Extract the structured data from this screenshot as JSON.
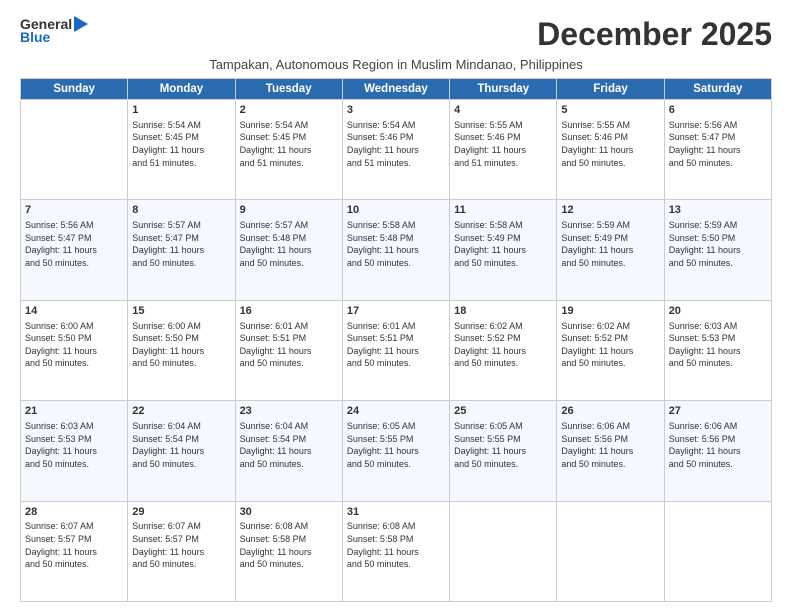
{
  "logo": {
    "general": "General",
    "blue": "Blue"
  },
  "title": "December 2025",
  "subtitle": "Tampakan, Autonomous Region in Muslim Mindanao, Philippines",
  "days": [
    "Sunday",
    "Monday",
    "Tuesday",
    "Wednesday",
    "Thursday",
    "Friday",
    "Saturday"
  ],
  "weeks": [
    [
      {
        "date": "",
        "info": ""
      },
      {
        "date": "1",
        "info": "Sunrise: 5:54 AM\nSunset: 5:45 PM\nDaylight: 11 hours\nand 51 minutes."
      },
      {
        "date": "2",
        "info": "Sunrise: 5:54 AM\nSunset: 5:45 PM\nDaylight: 11 hours\nand 51 minutes."
      },
      {
        "date": "3",
        "info": "Sunrise: 5:54 AM\nSunset: 5:46 PM\nDaylight: 11 hours\nand 51 minutes."
      },
      {
        "date": "4",
        "info": "Sunrise: 5:55 AM\nSunset: 5:46 PM\nDaylight: 11 hours\nand 51 minutes."
      },
      {
        "date": "5",
        "info": "Sunrise: 5:55 AM\nSunset: 5:46 PM\nDaylight: 11 hours\nand 50 minutes."
      },
      {
        "date": "6",
        "info": "Sunrise: 5:56 AM\nSunset: 5:47 PM\nDaylight: 11 hours\nand 50 minutes."
      }
    ],
    [
      {
        "date": "7",
        "info": "Sunrise: 5:56 AM\nSunset: 5:47 PM\nDaylight: 11 hours\nand 50 minutes."
      },
      {
        "date": "8",
        "info": "Sunrise: 5:57 AM\nSunset: 5:47 PM\nDaylight: 11 hours\nand 50 minutes."
      },
      {
        "date": "9",
        "info": "Sunrise: 5:57 AM\nSunset: 5:48 PM\nDaylight: 11 hours\nand 50 minutes."
      },
      {
        "date": "10",
        "info": "Sunrise: 5:58 AM\nSunset: 5:48 PM\nDaylight: 11 hours\nand 50 minutes."
      },
      {
        "date": "11",
        "info": "Sunrise: 5:58 AM\nSunset: 5:49 PM\nDaylight: 11 hours\nand 50 minutes."
      },
      {
        "date": "12",
        "info": "Sunrise: 5:59 AM\nSunset: 5:49 PM\nDaylight: 11 hours\nand 50 minutes."
      },
      {
        "date": "13",
        "info": "Sunrise: 5:59 AM\nSunset: 5:50 PM\nDaylight: 11 hours\nand 50 minutes."
      }
    ],
    [
      {
        "date": "14",
        "info": "Sunrise: 6:00 AM\nSunset: 5:50 PM\nDaylight: 11 hours\nand 50 minutes."
      },
      {
        "date": "15",
        "info": "Sunrise: 6:00 AM\nSunset: 5:50 PM\nDaylight: 11 hours\nand 50 minutes."
      },
      {
        "date": "16",
        "info": "Sunrise: 6:01 AM\nSunset: 5:51 PM\nDaylight: 11 hours\nand 50 minutes."
      },
      {
        "date": "17",
        "info": "Sunrise: 6:01 AM\nSunset: 5:51 PM\nDaylight: 11 hours\nand 50 minutes."
      },
      {
        "date": "18",
        "info": "Sunrise: 6:02 AM\nSunset: 5:52 PM\nDaylight: 11 hours\nand 50 minutes."
      },
      {
        "date": "19",
        "info": "Sunrise: 6:02 AM\nSunset: 5:52 PM\nDaylight: 11 hours\nand 50 minutes."
      },
      {
        "date": "20",
        "info": "Sunrise: 6:03 AM\nSunset: 5:53 PM\nDaylight: 11 hours\nand 50 minutes."
      }
    ],
    [
      {
        "date": "21",
        "info": "Sunrise: 6:03 AM\nSunset: 5:53 PM\nDaylight: 11 hours\nand 50 minutes."
      },
      {
        "date": "22",
        "info": "Sunrise: 6:04 AM\nSunset: 5:54 PM\nDaylight: 11 hours\nand 50 minutes."
      },
      {
        "date": "23",
        "info": "Sunrise: 6:04 AM\nSunset: 5:54 PM\nDaylight: 11 hours\nand 50 minutes."
      },
      {
        "date": "24",
        "info": "Sunrise: 6:05 AM\nSunset: 5:55 PM\nDaylight: 11 hours\nand 50 minutes."
      },
      {
        "date": "25",
        "info": "Sunrise: 6:05 AM\nSunset: 5:55 PM\nDaylight: 11 hours\nand 50 minutes."
      },
      {
        "date": "26",
        "info": "Sunrise: 6:06 AM\nSunset: 5:56 PM\nDaylight: 11 hours\nand 50 minutes."
      },
      {
        "date": "27",
        "info": "Sunrise: 6:06 AM\nSunset: 5:56 PM\nDaylight: 11 hours\nand 50 minutes."
      }
    ],
    [
      {
        "date": "28",
        "info": "Sunrise: 6:07 AM\nSunset: 5:57 PM\nDaylight: 11 hours\nand 50 minutes."
      },
      {
        "date": "29",
        "info": "Sunrise: 6:07 AM\nSunset: 5:57 PM\nDaylight: 11 hours\nand 50 minutes."
      },
      {
        "date": "30",
        "info": "Sunrise: 6:08 AM\nSunset: 5:58 PM\nDaylight: 11 hours\nand 50 minutes."
      },
      {
        "date": "31",
        "info": "Sunrise: 6:08 AM\nSunset: 5:58 PM\nDaylight: 11 hours\nand 50 minutes."
      },
      {
        "date": "",
        "info": ""
      },
      {
        "date": "",
        "info": ""
      },
      {
        "date": "",
        "info": ""
      }
    ]
  ]
}
